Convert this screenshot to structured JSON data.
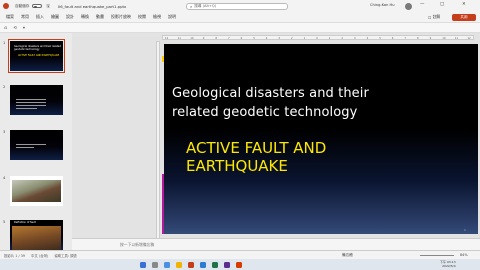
{
  "titlebar": {
    "autosave_label": "自動儲存",
    "filename": "06_fault and earthquake_part1.pptx",
    "search_placeholder": "搜尋 (Alt+Q)",
    "user_name": "Ching-Kan Hu",
    "win_min": "—",
    "win_max": "□",
    "win_close": "✕"
  },
  "menu": {
    "items": [
      "檔案",
      "常用",
      "插入",
      "繪圖",
      "設計",
      "轉換",
      "動畫",
      "投影片放映",
      "校閱",
      "檢視",
      "說明"
    ],
    "comment_label": "註解",
    "share_label": "共用"
  },
  "toolbar": {
    "icons": [
      "⎌",
      "⟲",
      "▾"
    ],
    "new_slide_label": "投影片尺寸"
  },
  "thumbnails": [
    {
      "num": "1",
      "title": "Geological disasters and their related geodetic technology",
      "subtitle": "ACTIVE FAULT AND EARTHQUAKE"
    },
    {
      "num": "2"
    },
    {
      "num": "3"
    },
    {
      "num": "4"
    },
    {
      "num": "5",
      "caption": "Definition of fault"
    }
  ],
  "ruler_ticks": [
    "12",
    "11",
    "10",
    "9",
    "8",
    "7",
    "6",
    "5",
    "4",
    "3",
    "2",
    "1",
    "0",
    "1",
    "2",
    "3",
    "4",
    "5",
    "6",
    "7",
    "8",
    "9",
    "10",
    "11",
    "12"
  ],
  "slide": {
    "title": "Geological disasters and their related geodetic technology",
    "subtitle": "ACTIVE FAULT AND EARTHQUAKE",
    "page_number": "1"
  },
  "notes": {
    "placeholder": "按一下以新增備忘稿"
  },
  "status": {
    "slide_info": "投影片 1 / 39",
    "language": "中文 (台灣)",
    "accessibility": "協助工具: 調查",
    "notes_label": "備忘稿",
    "zoom": "84%"
  },
  "clock": {
    "time": "下午 03:13",
    "date": "2022/5/4"
  },
  "colors": {
    "accent": "#c43e1c",
    "slide_title": "#ffffff",
    "slide_subtitle": "#ffe800"
  }
}
